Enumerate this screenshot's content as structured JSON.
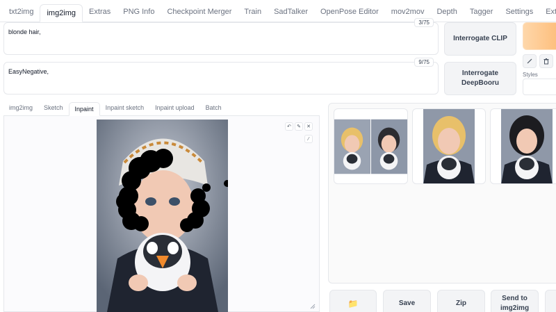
{
  "top_tabs": [
    "txt2img",
    "img2img",
    "Extras",
    "PNG Info",
    "Checkpoint Merger",
    "Train",
    "SadTalker",
    "OpenPose Editor",
    "mov2mov",
    "Depth",
    "Tagger",
    "Settings",
    "Extensions"
  ],
  "prompt": {
    "text": "blonde hair,",
    "counter": "3/75"
  },
  "negative_prompt": {
    "text": "EasyNegative,",
    "counter": "9/75"
  },
  "buttons": {
    "interrogate_clip": "Interrogate CLIP",
    "interrogate_deepbooru_line1": "Interrogate",
    "interrogate_deepbooru_line2": "DeepBooru",
    "styles_label": "Styles",
    "save": "Save",
    "zip": "Zip",
    "send_line1": "Send to",
    "send_line2": "img2img",
    "folder_icon": "📁"
  },
  "sub_tabs": [
    "img2img",
    "Sketch",
    "Inpaint",
    "Inpaint sketch",
    "Inpaint upload",
    "Batch"
  ],
  "active_top_tab": "img2img",
  "active_sub_tab": "Inpaint",
  "colors": {
    "generate_gradient_start": "#fed7aa",
    "generate_gradient_end": "#fdba74",
    "mask": "#000000"
  }
}
